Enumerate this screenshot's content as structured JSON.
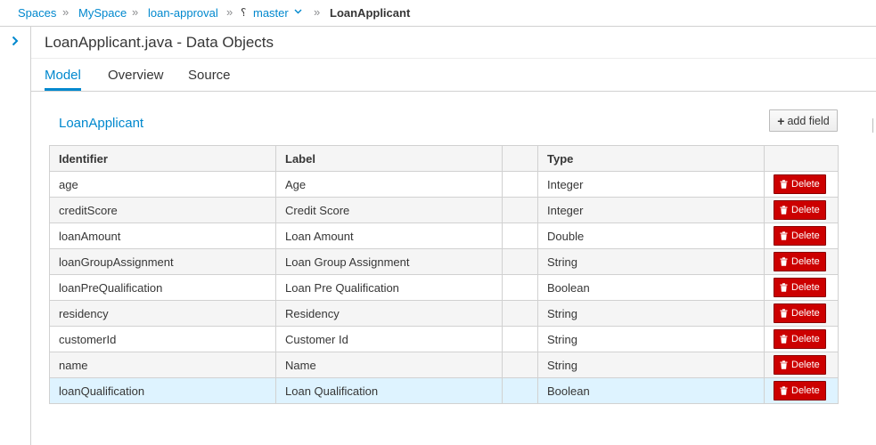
{
  "breadcrumb": {
    "spaces": "Spaces",
    "space": "MySpace",
    "project": "loan-approval",
    "branch": "master",
    "current": "LoanApplicant",
    "separator": "»"
  },
  "title": "LoanApplicant.java - Data Objects",
  "tabs": {
    "model": "Model",
    "overview": "Overview",
    "source": "Source"
  },
  "object_name": "LoanApplicant",
  "add_field_label": "add field",
  "table": {
    "headers": {
      "identifier": "Identifier",
      "label": "Label",
      "empty": "",
      "type": "Type",
      "actions": ""
    },
    "delete_label": "Delete",
    "rows": [
      {
        "identifier": "age",
        "label": "Age",
        "type": "Integer"
      },
      {
        "identifier": "creditScore",
        "label": "Credit Score",
        "type": "Integer"
      },
      {
        "identifier": "loanAmount",
        "label": "Loan Amount",
        "type": "Double"
      },
      {
        "identifier": "loanGroupAssignment",
        "label": "Loan Group Assignment",
        "type": "String"
      },
      {
        "identifier": "loanPreQualification",
        "label": "Loan Pre Qualification",
        "type": "Boolean"
      },
      {
        "identifier": "residency",
        "label": "Residency",
        "type": "String"
      },
      {
        "identifier": "customerId",
        "label": "Customer Id",
        "type": "String"
      },
      {
        "identifier": "name",
        "label": "Name",
        "type": "String"
      },
      {
        "identifier": "loanQualification",
        "label": "Loan Qualification",
        "type": "Boolean"
      }
    ]
  },
  "icons": {
    "branch": "git-branch-icon",
    "caret": "chevron-down-icon",
    "expand": "chevron-right-icon",
    "add": "plus-icon",
    "delete": "trash-icon"
  },
  "colors": {
    "accent": "#0088ce",
    "danger": "#cc0000",
    "selected_row": "#def3ff"
  }
}
